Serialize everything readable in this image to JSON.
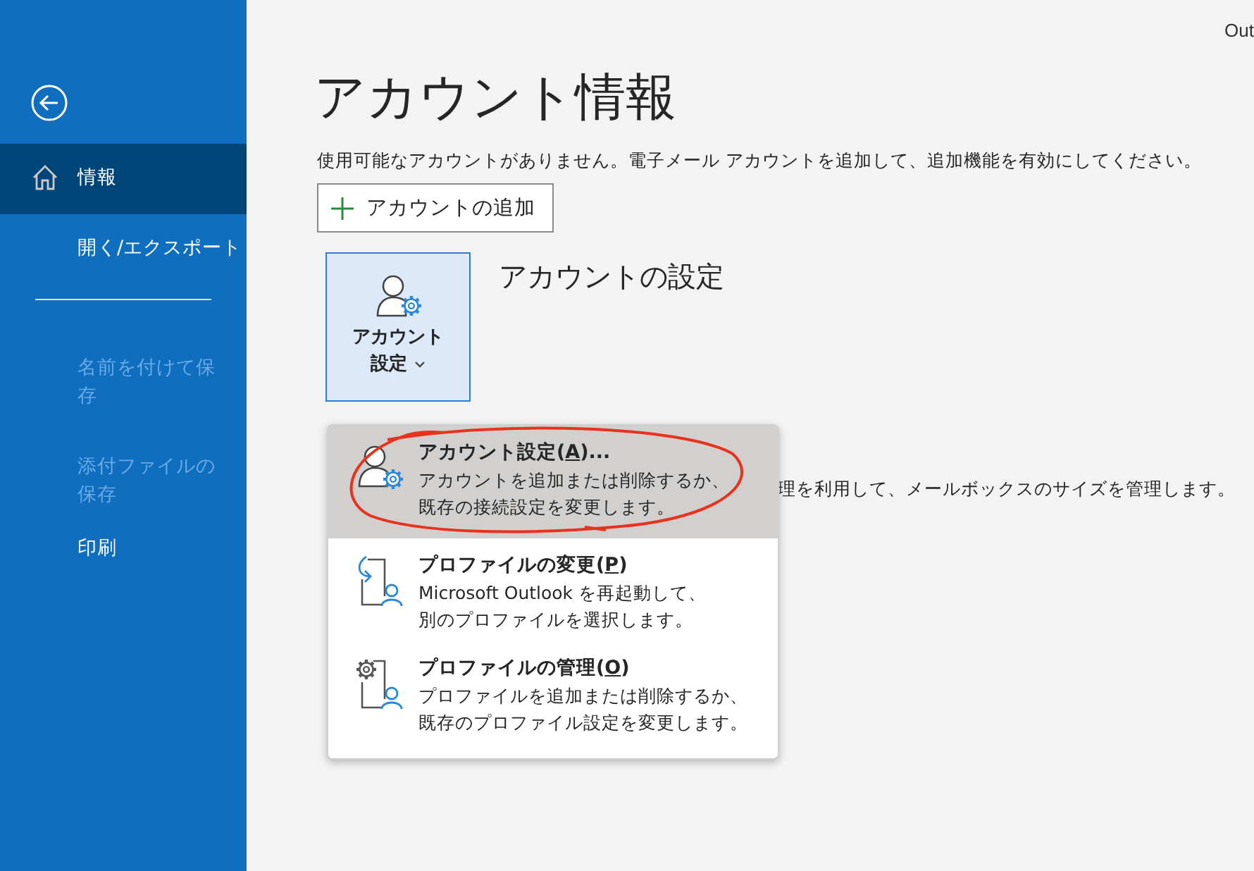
{
  "window": {
    "title_fragment": "Out"
  },
  "sidebar": {
    "items": [
      {
        "kind": "item",
        "label": "情報",
        "selected": true,
        "disabled": false
      },
      {
        "kind": "item",
        "label": "開く/エクスポート",
        "selected": false,
        "disabled": false
      },
      {
        "kind": "divider"
      },
      {
        "kind": "item",
        "label": "名前を付けて保存",
        "selected": false,
        "disabled": true
      },
      {
        "kind": "item",
        "label": "添付ファイルの保存",
        "selected": false,
        "disabled": true
      },
      {
        "kind": "item",
        "label": "印刷",
        "selected": false,
        "disabled": false
      }
    ]
  },
  "heading": "アカウント情報",
  "notice": "使用可能なアカウントがありません。電子メール アカウントを追加して、追加機能を有効にしてください。",
  "add_account_button": "アカウントの追加",
  "account_settings": {
    "button_line1": "アカウント",
    "button_line2": "設定",
    "section_title": "アカウントの設定"
  },
  "hidden_description": "理を利用して、メールボックスのサイズを管理します。",
  "menu": {
    "items": [
      {
        "title": "アカウント設定(",
        "key": "A",
        "rest": ")...",
        "description": [
          "アカウントを追加または削除するか、",
          "既存の接続設定を変更します。"
        ],
        "selected": true,
        "circled": true
      },
      {
        "title": "プロファイルの変更(",
        "key": "P",
        "rest": ")",
        "description": [
          "Microsoft Outlook を再起動して、",
          "別のプロファイルを選択します。"
        ],
        "selected": false,
        "circled": false
      },
      {
        "title": "プロファイルの管理(",
        "key": "O",
        "rest": ")",
        "description": [
          "プロファイルを追加または削除するか、",
          "既存のプロファイル設定を変更します。"
        ],
        "selected": false,
        "circled": false
      }
    ]
  }
}
